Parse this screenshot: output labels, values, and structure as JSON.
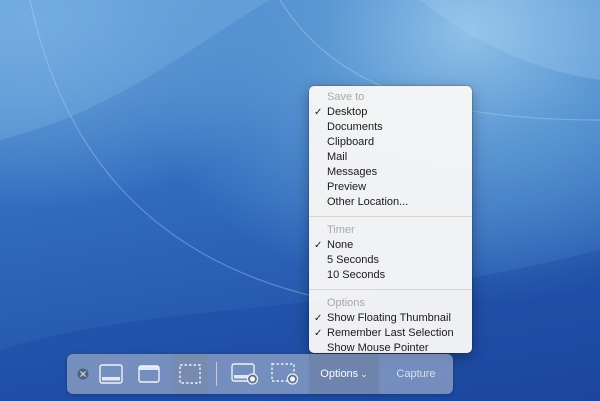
{
  "menu": {
    "save_to": {
      "header": "Save to",
      "items": [
        {
          "label": "Desktop",
          "checked": true
        },
        {
          "label": "Documents",
          "checked": false
        },
        {
          "label": "Clipboard",
          "checked": false
        },
        {
          "label": "Mail",
          "checked": false
        },
        {
          "label": "Messages",
          "checked": false
        },
        {
          "label": "Preview",
          "checked": false
        },
        {
          "label": "Other Location...",
          "checked": false
        }
      ]
    },
    "timer": {
      "header": "Timer",
      "items": [
        {
          "label": "None",
          "checked": true
        },
        {
          "label": "5 Seconds",
          "checked": false
        },
        {
          "label": "10 Seconds",
          "checked": false
        }
      ]
    },
    "options": {
      "header": "Options",
      "items": [
        {
          "label": "Show Floating Thumbnail",
          "checked": true
        },
        {
          "label": "Remember Last Selection",
          "checked": true
        },
        {
          "label": "Show Mouse Pointer",
          "checked": false
        }
      ]
    },
    "check_glyph": "✓"
  },
  "toolbar": {
    "close_icon": "close-icon",
    "capture_entire_screen_icon": "capture-entire-screen-icon",
    "capture_window_icon": "capture-window-icon",
    "capture_selection_icon": "capture-selection-icon",
    "record_screen_icon": "record-entire-screen-icon",
    "record_selection_icon": "record-selection-icon",
    "options_label": "Options",
    "options_chevron": "⌄",
    "capture_label": "Capture",
    "selected_mode": "capture-selection"
  },
  "colors": {
    "menu_header": "#a8a8a8",
    "menu_text": "#1a1a1a",
    "toolbar_bg": "#96a8c8",
    "options_bg": "#6e82a8"
  }
}
